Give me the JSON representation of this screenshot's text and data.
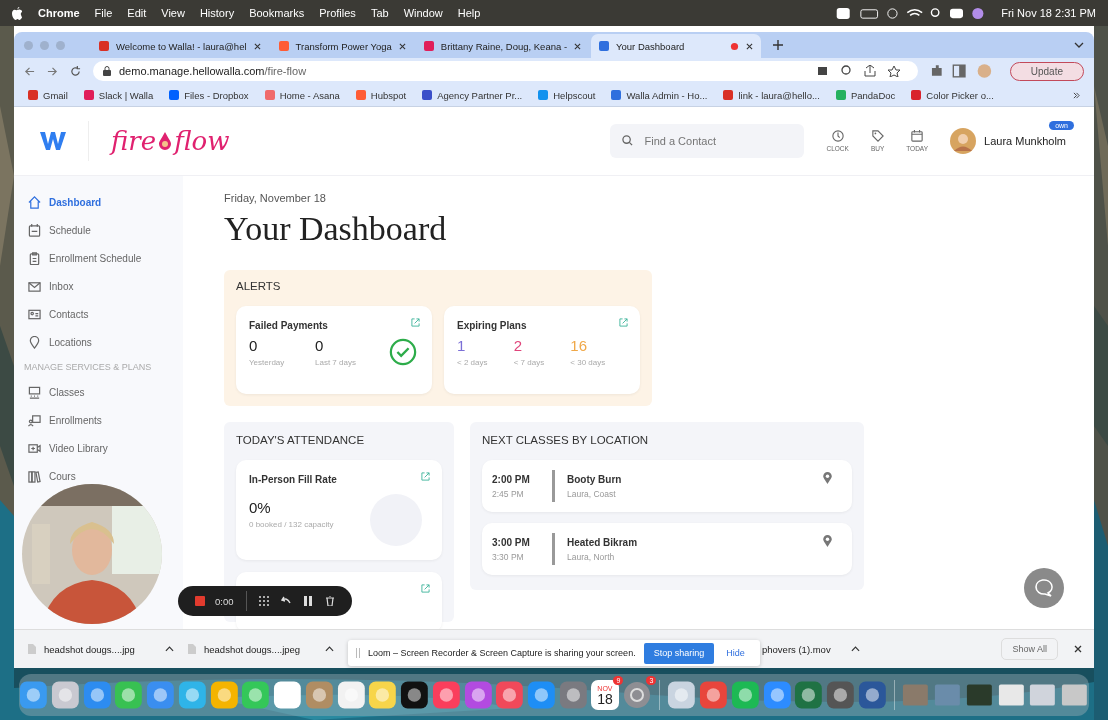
{
  "menubar": {
    "app": "Chrome",
    "menus": [
      "File",
      "Edit",
      "View",
      "History",
      "Bookmarks",
      "Profiles",
      "Tab",
      "Window",
      "Help"
    ],
    "clock": "Fri Nov 18  2:31 PM"
  },
  "tabs": [
    {
      "title": "Welcome to Walla! - laura@hel",
      "kind": "gmail",
      "selected": false
    },
    {
      "title": "Transform Power Yoga",
      "kind": "hubspot",
      "selected": false
    },
    {
      "title": "Brittany Raine, Doug, Keana -",
      "kind": "slack",
      "selected": false
    },
    {
      "title": "Your Dashboard",
      "kind": "walla",
      "selected": true
    }
  ],
  "address": {
    "host": "demo.manage.hellowalla.com",
    "path": "/fire-flow"
  },
  "update_button": "Update",
  "bookmarks": [
    {
      "label": "Gmail",
      "kind": "gmail"
    },
    {
      "label": "Slack | Walla",
      "kind": "slack"
    },
    {
      "label": "Files - Dropbox",
      "kind": "dropbox"
    },
    {
      "label": "Home - Asana",
      "kind": "asana"
    },
    {
      "label": "Hubspot",
      "kind": "hubspot"
    },
    {
      "label": "Agency Partner Pr...",
      "kind": "agency"
    },
    {
      "label": "Helpscout",
      "kind": "helpscout"
    },
    {
      "label": "Walla Admin - Ho...",
      "kind": "walla"
    },
    {
      "label": "link - laura@hello...",
      "kind": "gmail"
    },
    {
      "label": "PandaDoc",
      "kind": "pandadoc"
    },
    {
      "label": "Color Picker o...",
      "kind": "picker"
    }
  ],
  "header": {
    "logo_left": "fire",
    "logo_right": "flow",
    "search": {
      "placeholder": "Find a Contact"
    },
    "actions": [
      {
        "label": "CLOCK",
        "kind": "clock"
      },
      {
        "label": "BUY",
        "kind": "tag"
      },
      {
        "label": "TODAY",
        "kind": "calendar"
      }
    ],
    "user": {
      "name": "Laura Munkholm",
      "badge": "own"
    }
  },
  "sidebar": {
    "items": [
      {
        "label": "Dashboard",
        "kind": "home",
        "selected": true
      },
      {
        "label": "Schedule",
        "kind": "calendar",
        "selected": false
      },
      {
        "label": "Enrollment Schedule",
        "kind": "clipboard",
        "selected": false
      },
      {
        "label": "Inbox",
        "kind": "mail",
        "selected": false
      },
      {
        "label": "Contacts",
        "kind": "card",
        "selected": false
      },
      {
        "label": "Locations",
        "kind": "pin",
        "selected": false
      }
    ],
    "section": "MANAGE SERVICES & PLANS",
    "items2": [
      {
        "label": "Classes",
        "kind": "classes",
        "selected": false
      },
      {
        "label": "Enrollments",
        "kind": "enroll",
        "selected": false
      },
      {
        "label": "Video Library",
        "kind": "video",
        "selected": false
      },
      {
        "label": "Cours",
        "kind": "books",
        "selected": false
      }
    ]
  },
  "page": {
    "date": "Friday, November 18",
    "title": "Your Dashboard"
  },
  "alerts": {
    "title": "ALERTS",
    "failed": {
      "title": "Failed Payments",
      "ok": true,
      "stats": [
        {
          "value": "0",
          "label": "Yesterday"
        },
        {
          "value": "0",
          "label": "Last 7 days"
        }
      ]
    },
    "expiring": {
      "title": "Expiring Plans",
      "stats": [
        {
          "value": "1",
          "label": "< 2 days",
          "color": "#7b6fd6"
        },
        {
          "value": "2",
          "label": "< 7 days",
          "color": "#e0457b"
        },
        {
          "value": "16",
          "label": "< 30 days",
          "color": "#f0a848"
        }
      ]
    }
  },
  "attendance": {
    "title": "TODAY'S ATTENDANCE",
    "card": {
      "title": "In-Person Fill Rate",
      "value": "0%",
      "detail": "0 booked / 132 capacity"
    }
  },
  "next_classes": {
    "title": "NEXT CLASSES BY LOCATION",
    "rows": [
      {
        "start": "2:00 PM",
        "end": "2:45 PM",
        "name": "Booty Burn",
        "place": "Laura, Coast"
      },
      {
        "start": "3:00 PM",
        "end": "3:30 PM",
        "name": "Heated Bikram",
        "place": "Laura, North"
      }
    ]
  },
  "loom_toolbar": {
    "time": "0:00"
  },
  "downloads": {
    "items": [
      "headshot dougs....jpg",
      "headshot dougs....jpeg",
      "phovers (1).mov"
    ],
    "show_all": "Show All"
  },
  "loom_banner": {
    "text": "Loom – Screen Recorder & Screen Capture is sharing your screen.",
    "stop": "Stop sharing",
    "hide": "Hide"
  },
  "dock": {
    "month": "NOV",
    "day": "18",
    "calendar_badge": "9",
    "settings_badge": "3"
  }
}
